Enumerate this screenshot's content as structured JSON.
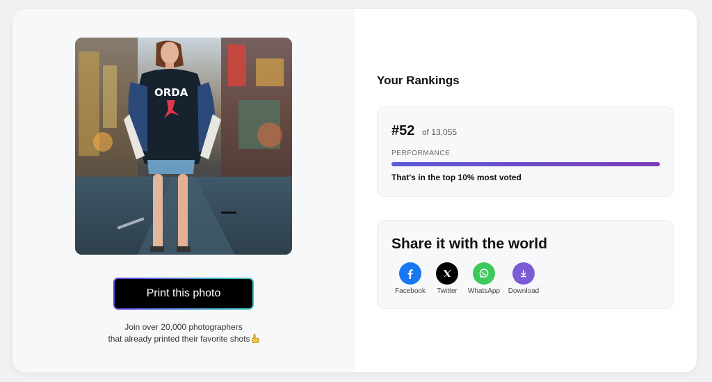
{
  "left": {
    "print_button": "Print this photo",
    "join_line1": "Join over 20,000 photographers",
    "join_line2": "that already printed their favorite shots"
  },
  "rankings": {
    "title": "Your Rankings",
    "rank": "#52",
    "of_total": "of 13,055",
    "performance_label": "PERFORMANCE",
    "performance_fraction": 1.0,
    "summary": "That's in the top 10% most voted"
  },
  "share": {
    "title": "Share it with the world",
    "buttons": [
      {
        "label": "Facebook",
        "icon": "facebook-icon",
        "color": "#1877f2"
      },
      {
        "label": "Twitter",
        "icon": "x-icon",
        "color": "#000000"
      },
      {
        "label": "WhatsApp",
        "icon": "whatsapp-icon",
        "color": "#3ec95d"
      },
      {
        "label": "Download",
        "icon": "download-icon",
        "color": "#7e5bd6"
      }
    ]
  },
  "colors": {
    "accent_gradient_start": "#5c5bd8",
    "accent_gradient_end": "#7e3fb8"
  }
}
